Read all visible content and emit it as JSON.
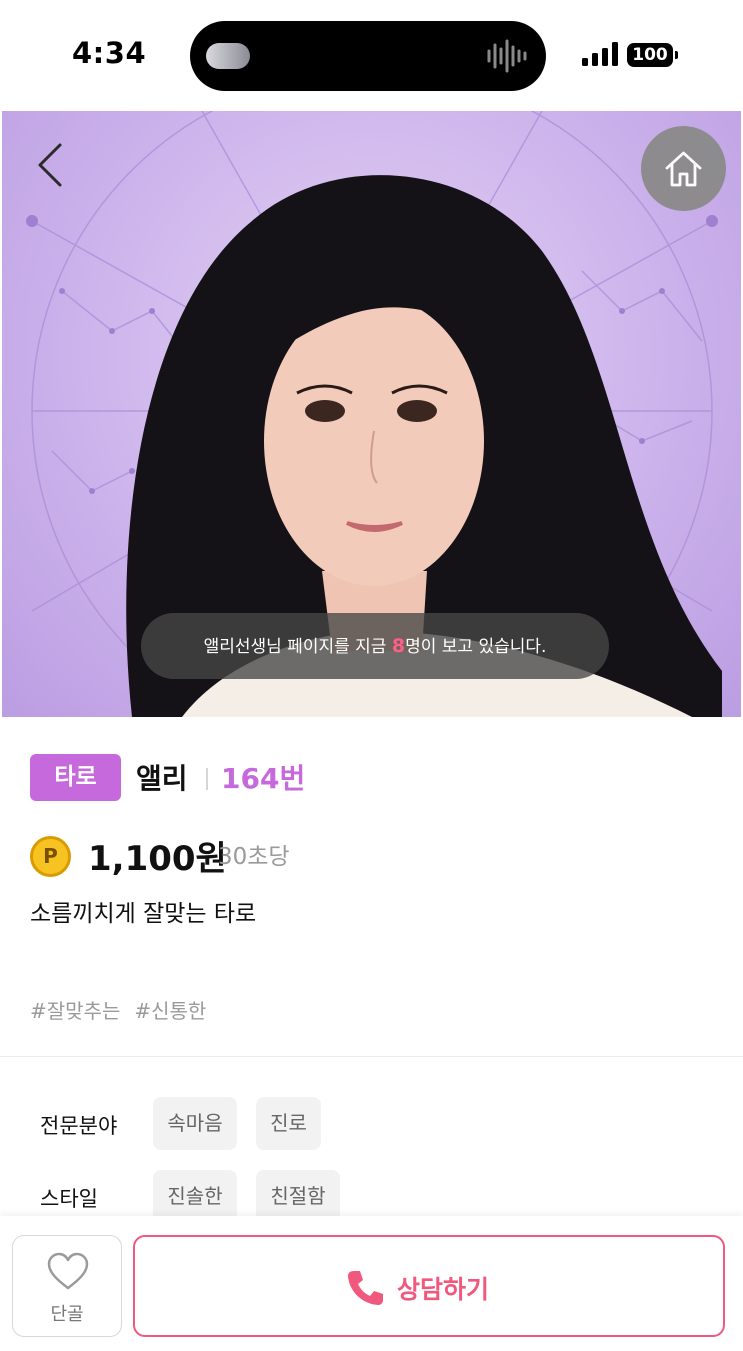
{
  "status_bar": {
    "time": "4:34",
    "battery": "100"
  },
  "hero": {
    "viewer_prefix": "앨리선생님 페이지를 지금 ",
    "viewer_count": "8",
    "viewer_suffix": "명이 보고 있습니다."
  },
  "profile": {
    "category": "타로",
    "name": "앨리",
    "number": "164번",
    "coin_symbol": "P",
    "price": "1,100원",
    "price_unit": "30초당",
    "tagline": "소름끼치게 잘맞는 타로",
    "hashtags": [
      "#잘맞추는",
      "#신통한"
    ]
  },
  "details": {
    "specialty_label": "전문분야",
    "specialties": [
      "속마음",
      "진로"
    ],
    "style_label": "스타일",
    "styles": [
      "진솔한",
      "친절함"
    ]
  },
  "bottom_bar": {
    "favorite_label": "단골",
    "consult_label": "상담하기"
  },
  "colors": {
    "accent_purple": "#c569dc",
    "accent_pink": "#f0587d",
    "hero_background": "#cdb4ec",
    "coin_gold": "#f6c323"
  }
}
